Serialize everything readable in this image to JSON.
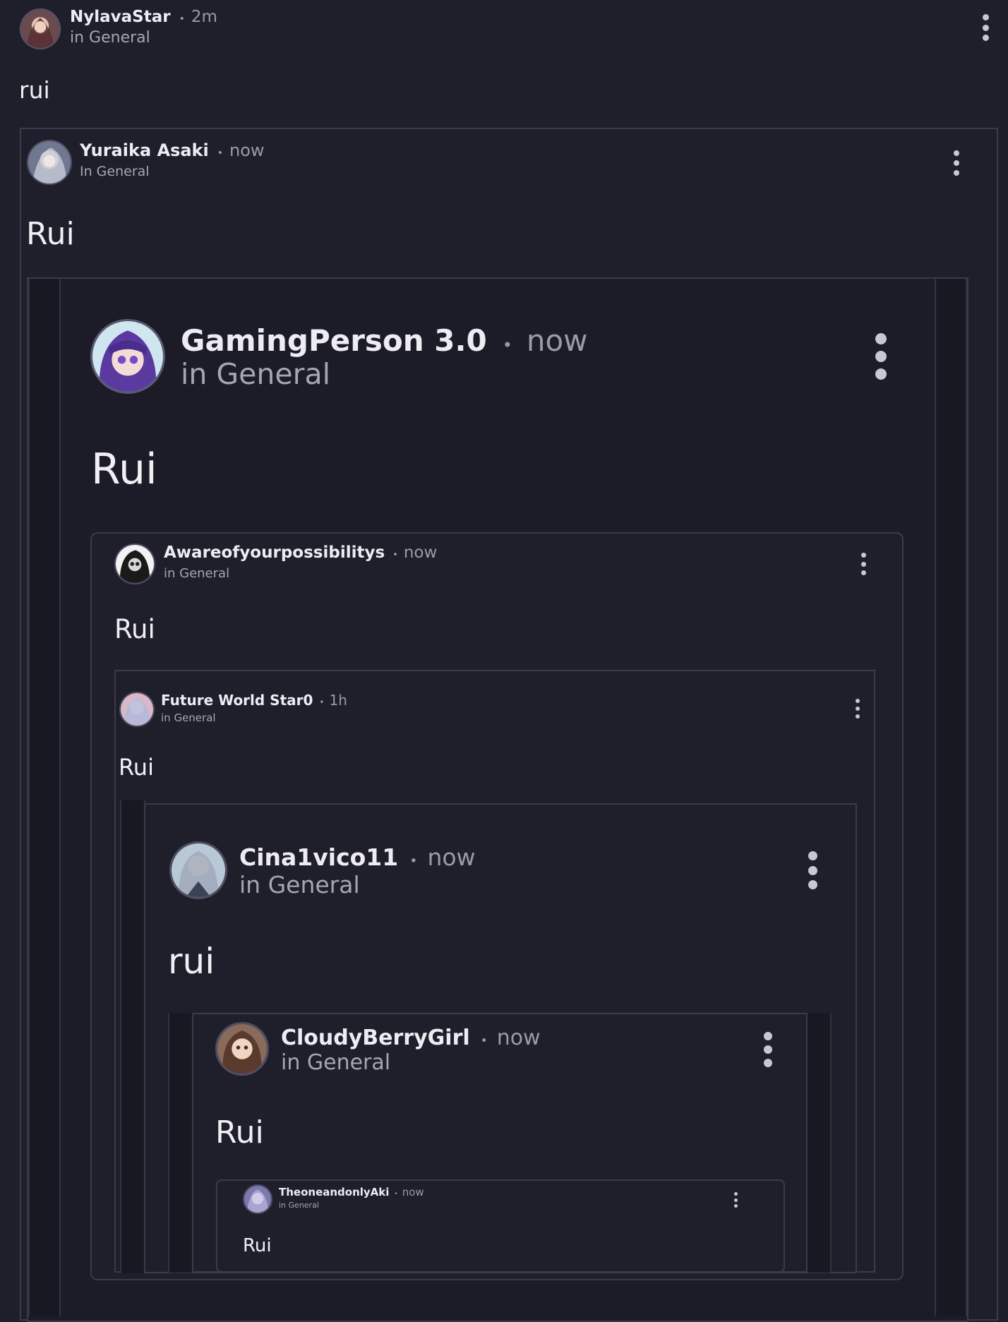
{
  "posts": [
    {
      "username": "NylavaStar",
      "time": "2m",
      "community": "in General",
      "text": "rui"
    },
    {
      "username": "Yuraika Asaki",
      "time": "now",
      "community": "In General",
      "text": "Rui"
    },
    {
      "username": "GamingPerson 3.0",
      "time": "now",
      "community": "in General",
      "text": "Rui"
    },
    {
      "username": "Awareofyourpossibilitys",
      "time": "now",
      "community": "in General",
      "text": "Rui"
    },
    {
      "username": "Future World Star0",
      "time": "1h",
      "community": "in General",
      "text": "Rui"
    },
    {
      "username": "Cina1vico11",
      "time": "now",
      "community": "in General",
      "text": "rui"
    },
    {
      "username": "CloudyBerryGirl",
      "time": "now",
      "community": "in General",
      "text": "Rui"
    },
    {
      "username": "TheoneandonlyAki",
      "time": "now",
      "community": "in General",
      "text": "Rui"
    }
  ],
  "separator": "•",
  "icons": {
    "avatar": "avatar-icon",
    "more": "more-vertical-icon"
  }
}
